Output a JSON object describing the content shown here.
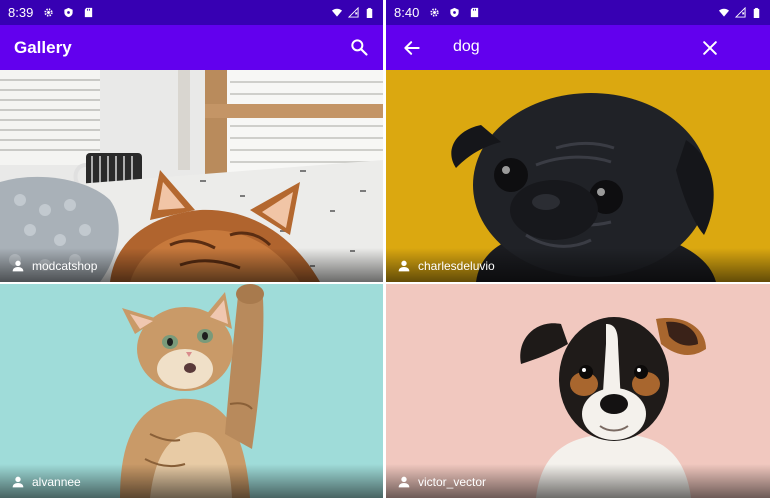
{
  "left_screen": {
    "status_time": "8:39",
    "title": "Gallery",
    "photos": [
      {
        "author": "modcatshop"
      },
      {
        "author": "alvannee"
      }
    ]
  },
  "right_screen": {
    "status_time": "8:40",
    "search_query": "dog",
    "photos": [
      {
        "author": "charlesdeluvio"
      },
      {
        "author": "victor_vector"
      }
    ]
  },
  "colors": {
    "status_bar": "#3700B3",
    "app_bar": "#6200EE"
  }
}
